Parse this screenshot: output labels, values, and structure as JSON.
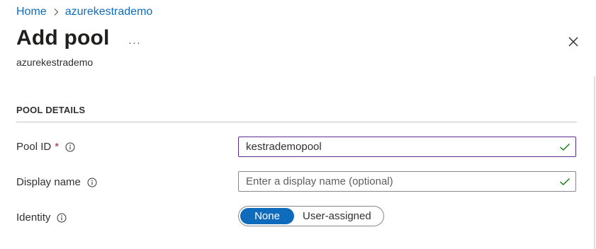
{
  "breadcrumb": {
    "home": "Home",
    "current": "azurekestrademo"
  },
  "header": {
    "title": "Add pool",
    "more": "···",
    "subtitle": "azurekestrademo"
  },
  "section": {
    "title": "POOL DETAILS"
  },
  "form": {
    "pool_id": {
      "label": "Pool ID",
      "required_marker": "*",
      "value": "kestrademopool"
    },
    "display_name": {
      "label": "Display name",
      "value": "",
      "placeholder": "Enter a display name (optional)"
    },
    "identity": {
      "label": "Identity",
      "options": [
        "None",
        "User-assigned"
      ],
      "selected": "None"
    }
  },
  "icons": {
    "info": "info-icon",
    "check": "checkmark-icon",
    "close": "close-icon",
    "chevron": "chevron-right-icon"
  },
  "colors": {
    "link": "#0f6cbd",
    "accent": "#0f6cbd",
    "valid": "#107c10",
    "required": "#a4262c",
    "focus_border": "#5c2e91"
  }
}
